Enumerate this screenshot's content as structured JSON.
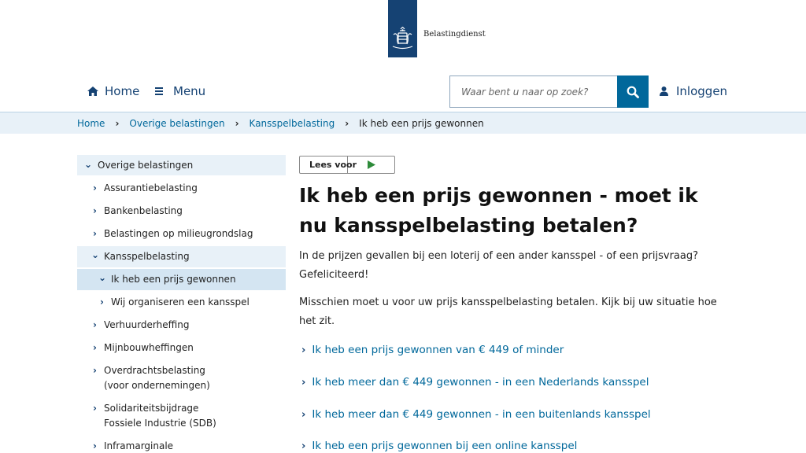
{
  "logo": {
    "text": "Belastingdienst",
    "crest": "royal-crest-icon"
  },
  "header": {
    "home_label": "Home",
    "menu_label": "Menu",
    "search_placeholder": "Waar bent u naar op zoek?",
    "login_label": "Inloggen"
  },
  "breadcrumb": {
    "items": [
      "Home",
      "Overige belastingen",
      "Kansspelbelasting"
    ],
    "current": "Ik heb een prijs gewonnen"
  },
  "sidebar": {
    "items": [
      {
        "label": "Overige belastingen",
        "state": "expanded",
        "level": 0
      },
      {
        "label": "Assurantiebelasting",
        "state": "collapsed",
        "level": 1
      },
      {
        "label": "Bankenbelasting",
        "state": "collapsed",
        "level": 1
      },
      {
        "label": "Belastingen op milieugrondslag",
        "state": "collapsed",
        "level": 1
      },
      {
        "label": "Kansspelbelasting",
        "state": "expanded",
        "level": 1
      },
      {
        "label": "Ik heb een prijs gewonnen",
        "state": "expanded",
        "level": 2
      },
      {
        "label": "Wij organiseren een kansspel",
        "state": "collapsed",
        "level": 2
      },
      {
        "label": "Verhuurderheffing",
        "state": "collapsed",
        "level": 1
      },
      {
        "label": "Mijnbouwheffingen",
        "state": "collapsed",
        "level": 1
      },
      {
        "label": "Overdrachtsbelasting",
        "label2": "(voor ondernemingen)",
        "state": "collapsed",
        "level": 1
      },
      {
        "label": "Solidariteitsbijdrage",
        "label2": "Fossiele Industrie (SDB)",
        "state": "collapsed",
        "level": 1
      },
      {
        "label": "Inframarginale",
        "state": "collapsed",
        "level": 1
      }
    ]
  },
  "readspeaker": {
    "label": "Lees voor"
  },
  "main": {
    "title": "Ik heb een prijs gewonnen - moet ik nu kansspelbelasting betalen?",
    "para1": "In de prijzen gevallen bij een loterij of een ander kansspel - of een prijsvraag? Gefeliciteerd!",
    "para2": "Misschien moet u voor uw prijs kansspelbelasting betalen. Kijk bij uw situatie hoe het zit.",
    "links": [
      "Ik heb een prijs gewonnen van € 449 of minder",
      "Ik heb meer dan € 449 gewonnen - in een Nederlands kansspel",
      "Ik heb meer dan € 449 gewonnen - in een buitenlands kansspel",
      "Ik heb een prijs gewonnen bij een online kansspel"
    ]
  },
  "colors": {
    "brand_blue": "#154273",
    "link_blue": "#01689b",
    "light_blue": "#e8f1f8"
  }
}
